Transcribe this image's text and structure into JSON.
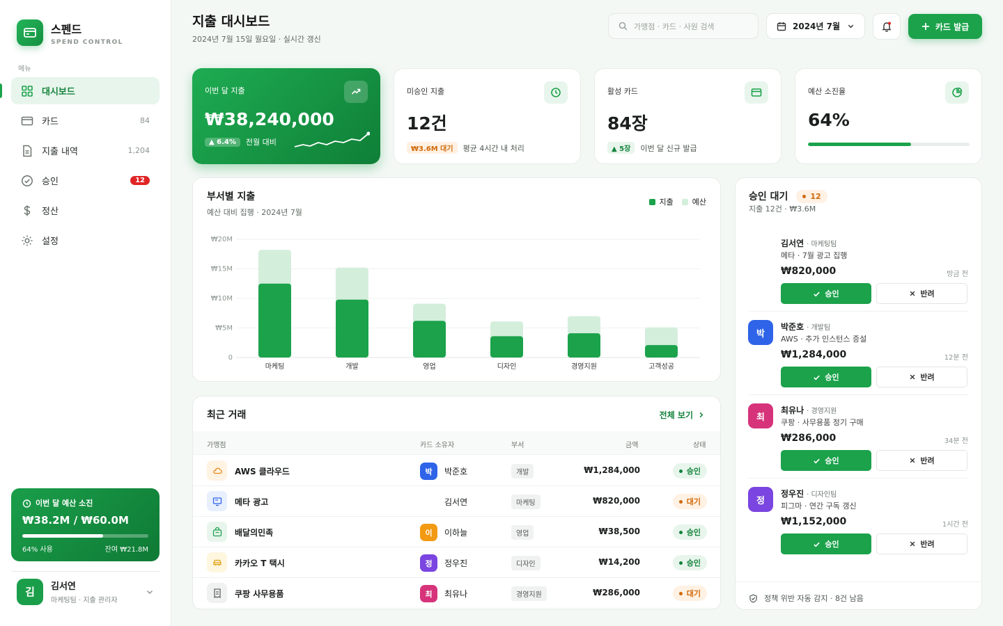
{
  "brand": {
    "name": "스펜드",
    "sub": "SPEND CONTROL"
  },
  "menu_label": "메뉴",
  "nav": [
    {
      "label": "대시보드",
      "icon": "grid-icon",
      "active": true
    },
    {
      "label": "카드",
      "icon": "card-icon",
      "count": "84"
    },
    {
      "label": "지출 내역",
      "icon": "document-icon",
      "count": "1,204"
    },
    {
      "label": "승인",
      "icon": "check-circle-icon",
      "badge": "12"
    },
    {
      "label": "정산",
      "icon": "dollar-icon"
    },
    {
      "label": "설정",
      "icon": "gear-icon"
    }
  ],
  "budget": {
    "title": "이번 달 예산 소진",
    "amount": "₩38.2M / ₩60.0M",
    "used": "64% 사용",
    "remaining": "잔여 ₩21.8M",
    "fraction": 0.64
  },
  "user": {
    "initial": "김",
    "name": "김서연",
    "role": "마케팅팀 · 지출 관리자"
  },
  "header": {
    "title": "지출 대시보드",
    "subtitle": "2024년 7월 15일 월요일 · 실시간 갱신"
  },
  "search": {
    "placeholder": "가맹점 · 카드 · 사원 검색"
  },
  "month": "2024년 7월",
  "issue_button": "카드 발급",
  "kpis": {
    "spend": {
      "label": "이번 달 지출",
      "value": "₩38,240,000",
      "delta": "▲ 6.4%",
      "note": "전월 대비"
    },
    "pending": {
      "label": "미승인 지출",
      "value": "12건",
      "pill": "₩3.6M 대기",
      "note": "평균 4시간 내 처리"
    },
    "cards": {
      "label": "활성 카드",
      "value": "84장",
      "pill": "▲ 5장",
      "note": "이번 달 신규 발급"
    },
    "budget": {
      "label": "예산 소진율",
      "value": "64%",
      "fraction": 0.64
    }
  },
  "dept_chart": {
    "title": "부서별 지출",
    "subtitle": "예산 대비 집행 · 2024년 7월"
  },
  "chart_data": {
    "type": "bar",
    "categories": [
      "마케팅",
      "개발",
      "영업",
      "디자인",
      "경영지원",
      "고객성공"
    ],
    "series": [
      {
        "name": "지출",
        "values": [
          12.5,
          9.8,
          6.2,
          3.6,
          4.1,
          2.1
        ]
      },
      {
        "name": "예산",
        "values": [
          18.2,
          15.2,
          9.1,
          6.1,
          7.0,
          5.1
        ]
      }
    ],
    "ylim": [
      0,
      20
    ],
    "yticks": [
      "0",
      "₩5M",
      "₩10M",
      "₩15M",
      "₩20M"
    ],
    "legend": "top-right",
    "colors": {
      "spend": "#1ba24b",
      "budget": "#d4eedc"
    }
  },
  "transactions": {
    "title": "최근 거래",
    "view_all": "전체 보기",
    "headers": [
      "가맹점",
      "카드 소유자",
      "부서",
      "금액",
      "상태"
    ],
    "rows": [
      {
        "merchant": "AWS 클라우드",
        "icon": "cloud-icon",
        "owner": "박준호",
        "initial": "박",
        "color": "#2f64e8",
        "dept": "개발",
        "amount": "₩1,284,000",
        "status": "승인",
        "state": "ok"
      },
      {
        "merchant": "메타 광고",
        "icon": "monitor-icon",
        "owner": "김서연",
        "initial": "",
        "color": "",
        "dept": "마케팅",
        "amount": "₩820,000",
        "status": "대기",
        "state": "wait"
      },
      {
        "merchant": "배달의민족",
        "icon": "bag-icon",
        "owner": "이하늘",
        "initial": "이",
        "color": "#f29a12",
        "dept": "영업",
        "amount": "₩38,500",
        "status": "승인",
        "state": "ok"
      },
      {
        "merchant": "카카오 T 택시",
        "icon": "car-icon",
        "owner": "정우진",
        "initial": "정",
        "color": "#7a45e0",
        "dept": "디자인",
        "amount": "₩14,200",
        "status": "승인",
        "state": "ok"
      },
      {
        "merchant": "쿠팡 사무용품",
        "icon": "receipt-icon",
        "owner": "최유나",
        "initial": "최",
        "color": "#d6337a",
        "dept": "경영지원",
        "amount": "₩286,000",
        "status": "대기",
        "state": "wait"
      }
    ]
  },
  "approvals": {
    "title": "승인 대기",
    "badge": "12",
    "subtitle": "지출 12건 · ₩3.6M",
    "approve": "승인",
    "reject": "반려",
    "items": [
      {
        "name": "김서연",
        "team": "· 마케팅팀",
        "desc": "메타 · 7월 광고 집행",
        "amount": "₩820,000",
        "time": "방금 전",
        "initial": "",
        "color": ""
      },
      {
        "name": "박준호",
        "team": "· 개발팀",
        "desc": "AWS · 추가 인스턴스 증설",
        "amount": "₩1,284,000",
        "time": "12분 전",
        "initial": "박",
        "color": "#2f64e8"
      },
      {
        "name": "최유나",
        "team": "· 경영지원",
        "desc": "쿠팡 · 사무용품 정기 구매",
        "amount": "₩286,000",
        "time": "34분 전",
        "initial": "최",
        "color": "#d6337a"
      },
      {
        "name": "정우진",
        "team": "· 디자인팀",
        "desc": "피그마 · 연간 구독 갱신",
        "amount": "₩1,152,000",
        "time": "1시간 전",
        "initial": "정",
        "color": "#7a45e0"
      }
    ],
    "footer": "정책 위반 자동 감지 · 8건 남음"
  }
}
